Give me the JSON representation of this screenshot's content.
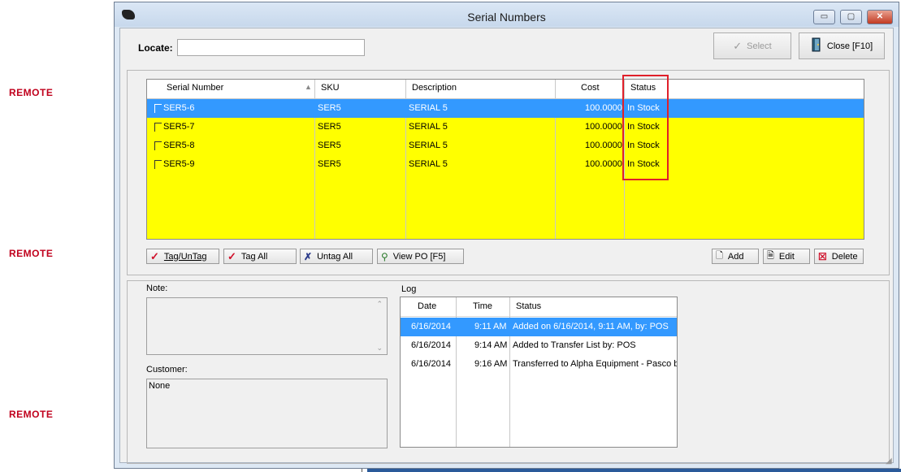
{
  "side_labels": [
    "REMOTE",
    "REMOTE",
    "REMOTE"
  ],
  "window": {
    "title": "Serial Numbers",
    "controls": {
      "minimize": "▭",
      "maximize": "▢",
      "close": "✕"
    }
  },
  "locate": {
    "label": "Locate:",
    "value": ""
  },
  "toolbar": {
    "select_label": "Select",
    "close_label": "Close [F10]"
  },
  "grid": {
    "columns": [
      "Serial Number",
      "SKU",
      "Description",
      "Cost",
      "Status"
    ],
    "sort_indicator": "▲",
    "rows": [
      {
        "serial": "SER5-6",
        "sku": "SER5",
        "description": "SERIAL 5",
        "cost": "100.0000",
        "status": "In Stock",
        "selected": true
      },
      {
        "serial": "SER5-7",
        "sku": "SER5",
        "description": "SERIAL 5",
        "cost": "100.0000",
        "status": "In Stock",
        "selected": false
      },
      {
        "serial": "SER5-8",
        "sku": "SER5",
        "description": "SERIAL 5",
        "cost": "100.0000",
        "status": "In Stock",
        "selected": false
      },
      {
        "serial": "SER5-9",
        "sku": "SER5",
        "description": "SERIAL 5",
        "cost": "100.0000",
        "status": "In Stock",
        "selected": false
      }
    ]
  },
  "buttons": {
    "tag_untag": "Tag/UnTag",
    "tag_all": "Tag All",
    "untag_all": "Untag All",
    "view_po": "View PO [F5]",
    "add": "Add",
    "edit": "Edit",
    "delete": "Delete"
  },
  "note": {
    "label": "Note:",
    "value": ""
  },
  "customer": {
    "label": "Customer:",
    "value": "None"
  },
  "log": {
    "label": "Log",
    "columns": [
      "Date",
      "Time",
      "Status"
    ],
    "rows": [
      {
        "date": "6/16/2014",
        "time": "9:11 AM",
        "status": "Added on  6/16/2014,  9:11 AM, by: POS",
        "selected": true
      },
      {
        "date": "6/16/2014",
        "time": "9:14 AM",
        "status": "Added to Transfer List by: POS",
        "selected": false
      },
      {
        "date": "6/16/2014",
        "time": "9:16 AM",
        "status": "Transferred to Alpha Equipment - Pasco by",
        "selected": false
      }
    ]
  },
  "colors": {
    "grid_bg": "#ffff00",
    "selection": "#3399ff",
    "highlight_box": "#e0202a",
    "remote_text": "#c0001c"
  }
}
